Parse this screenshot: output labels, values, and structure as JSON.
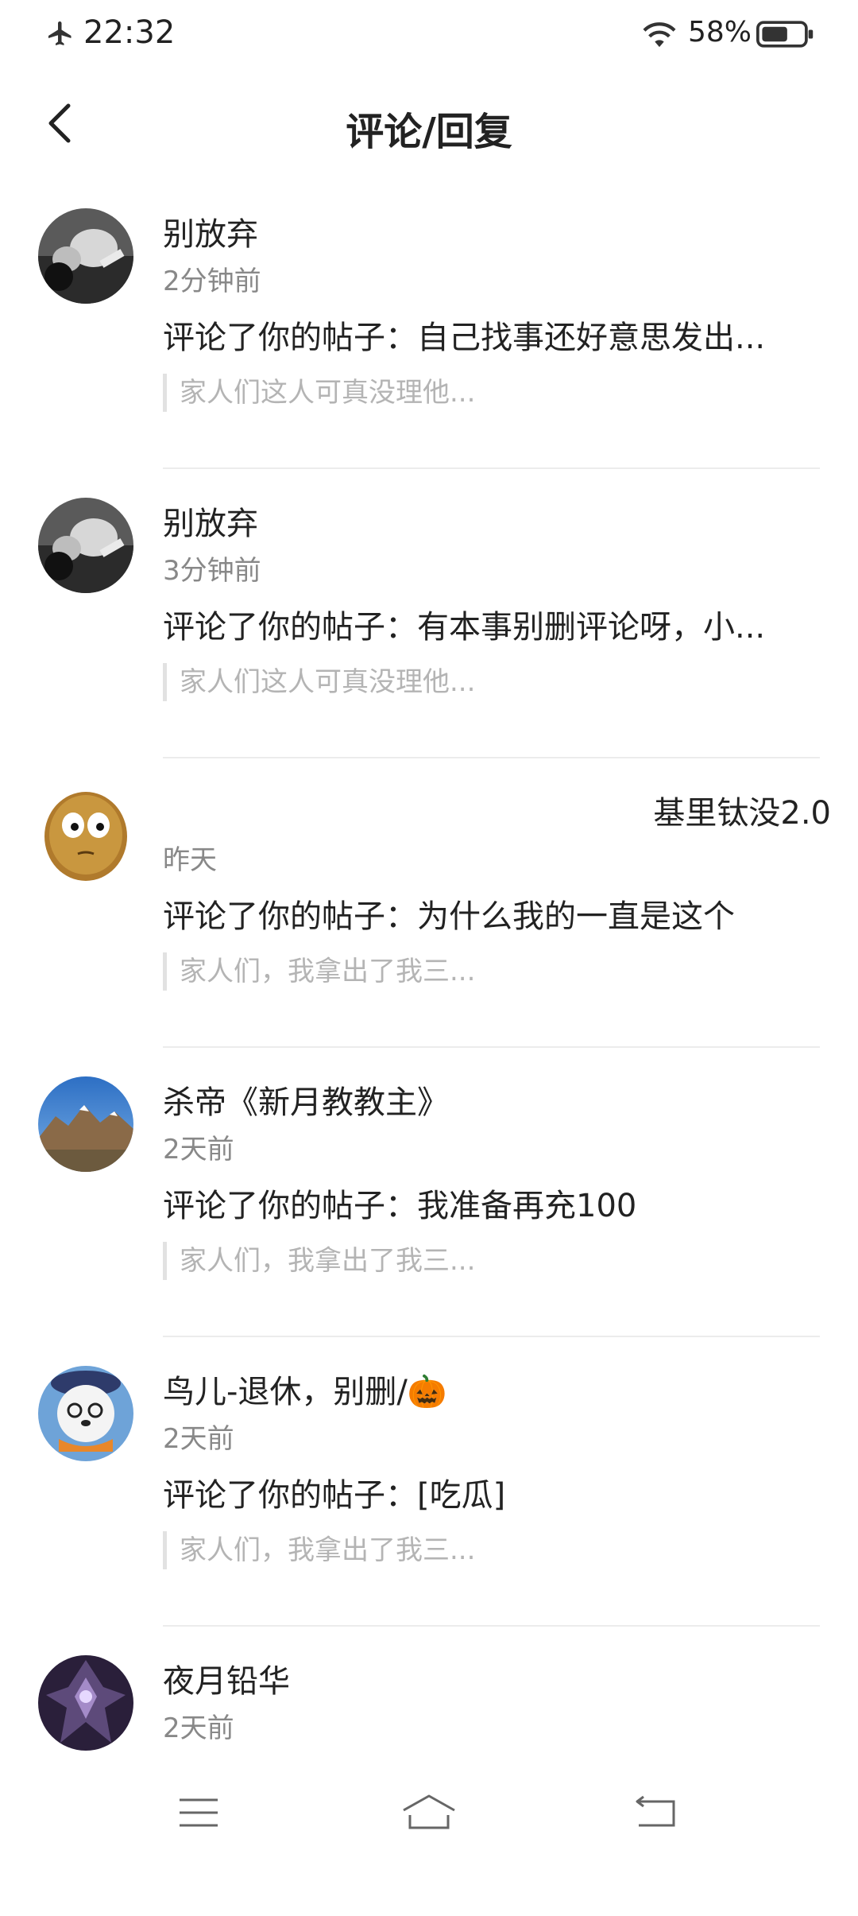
{
  "status_bar": {
    "time": "22:32",
    "battery": "58%",
    "icons": [
      "airplane-icon",
      "wifi-icon",
      "battery-icon"
    ]
  },
  "header": {
    "title": "评论/回复",
    "back_icon": "chevron-left-icon"
  },
  "comments": [
    {
      "name": "别放弃",
      "time": "2分钟前",
      "content": "评论了你的帖子：自己找事还好意思发出...",
      "quote": "家人们这人可真没理他..."
    },
    {
      "name": "别放弃",
      "time": "3分钟前",
      "content": "评论了你的帖子：有本事别删评论呀，小...",
      "quote": "家人们这人可真没理他..."
    },
    {
      "name": "基里钛没2.0",
      "time": "昨天",
      "content": "评论了你的帖子：为什么我的一直是这个",
      "quote": "家人们，我拿出了我三..."
    },
    {
      "name": "杀帝《新月教教主》",
      "time": "2天前",
      "content": "评论了你的帖子：我准备再充100",
      "quote": "家人们，我拿出了我三..."
    },
    {
      "name": "鸟儿-退休，别删/🎃",
      "time": "2天前",
      "content": "评论了你的帖子：[吃瓜]",
      "quote": "家人们，我拿出了我三..."
    },
    {
      "name": "夜月铅华",
      "time": "2天前"
    }
  ],
  "nav_bar": {
    "icons": [
      "menu-icon",
      "home-icon",
      "back-icon"
    ]
  }
}
